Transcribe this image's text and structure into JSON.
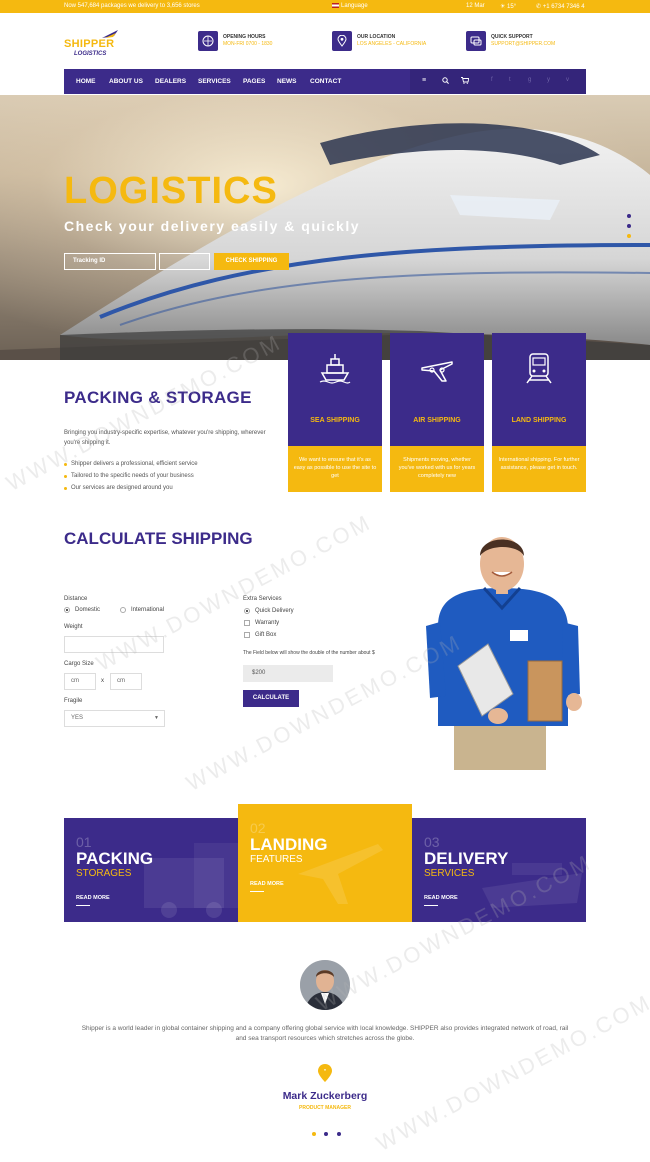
{
  "topbar": {
    "notice": "Now 547,684 packages we delivery to 3,656 stores",
    "language": "Language",
    "date": "12 Mar",
    "temperature": "15°",
    "phone": "+1 6734 7346 4"
  },
  "logo": {
    "main": "SHIPPER",
    "sub": "LOGISTICS"
  },
  "info": [
    {
      "title": "OPENING HOURS",
      "sub": "MON-FRI 0700 - 1830",
      "icon": "calendar-icon"
    },
    {
      "title": "OUR LOCATION",
      "sub": "LOS ANGELES - CALIFORNIA",
      "icon": "location-icon"
    },
    {
      "title": "QUICK SUPPORT",
      "sub": "SUPPORT@SHIPPER.COM",
      "icon": "chat-icon"
    }
  ],
  "nav": {
    "items": [
      "HOME",
      "ABOUT US",
      "DEALERS",
      "SERVICES",
      "PAGES",
      "NEWS",
      "CONTACT"
    ],
    "icons": [
      "menu-icon",
      "search-icon",
      "cart-icon"
    ],
    "social": [
      "f",
      "t",
      "g",
      "y",
      "v"
    ]
  },
  "hero": {
    "title": "LOGISTICS",
    "subtitle": "Check your delivery easily & quickly",
    "input_placeholder": "Tracking ID",
    "button": "CHECK SHIPPING"
  },
  "services": [
    {
      "title": "SEA SHIPPING",
      "desc": "We want to ensure that it's as easy as possible to use the site to get",
      "icon": "ship-icon"
    },
    {
      "title": "AIR SHIPPING",
      "desc": "Shipments moving, whether you've worked with us for years completely new",
      "icon": "plane-icon"
    },
    {
      "title": "LAND SHIPPING",
      "desc": "International shipping. For further assistance, please get in touch.",
      "icon": "train-icon"
    }
  ],
  "packing": {
    "title": "PACKING & STORAGE",
    "desc": "Bringing you industry-specific expertise, whatever you're shipping, wherever you're shipping it.",
    "list": [
      "Shipper delivers a professional, efficient service",
      "Tailored to the specific needs of your business",
      "Our services are designed around you"
    ]
  },
  "calc": {
    "title": "CALCULATE SHIPPING",
    "distance_label": "Distance",
    "domestic": "Domestic",
    "international": "International",
    "weight_label": "Weight",
    "cargo_label": "Cargo Size",
    "cm1": "cm",
    "x": "x",
    "cm2": "cm",
    "fragile_label": "Fragile",
    "fragile_value": "YES",
    "extra_label": "Extra Services",
    "extra": [
      "Quick Delivery",
      "Warranty",
      "Gift Box"
    ],
    "note": "The Field below will show the double of the number about $",
    "price": "$200",
    "button": "CALCULATE"
  },
  "features": [
    {
      "num": "01",
      "t1": "PACKING",
      "t2": "STORAGES",
      "more": "READ MORE"
    },
    {
      "num": "02",
      "t1": "LANDING",
      "t2": "FEATURES",
      "more": "READ MORE"
    },
    {
      "num": "03",
      "t1": "DELIVERY",
      "t2": "SERVICES",
      "more": "READ MORE"
    }
  ],
  "testimonial": {
    "quote": "Shipper is a world leader in global container shipping and a company offering global service with local knowledge. SHIPPER also provides integrated network of road, rail and sea transport resources which stretches across the globe.",
    "name": "Mark Zuckerberg",
    "role": "PRODUCT MANAGER"
  },
  "watermark": "WWW.DOWNDEMO.COM",
  "colors": {
    "primary": "#3c2b8a",
    "accent": "#f5b910"
  }
}
